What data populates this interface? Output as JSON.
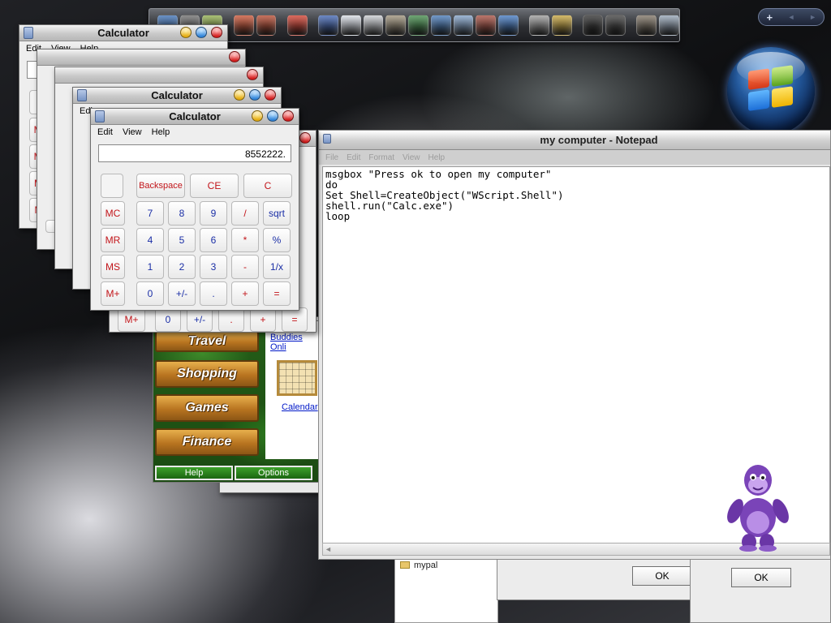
{
  "dock": {
    "icons": [
      {
        "name": "desktop-icon",
        "color": "#3a6fb5"
      },
      {
        "name": "film-reel-icon",
        "color": "#6b6b6b"
      },
      {
        "name": "disc-icon",
        "color": "#8fae4a"
      },
      {
        "name": "paint-palette-icon",
        "color": "#c94e2f"
      },
      {
        "name": "books-icon",
        "color": "#b5452b"
      },
      {
        "name": "magnet-icon",
        "color": "#d23a2a"
      },
      {
        "name": "network-icon",
        "color": "#3d62b2"
      },
      {
        "name": "document-icon",
        "color": "#d8dde6"
      },
      {
        "name": "calculator-icon",
        "color": "#c9ccd1"
      },
      {
        "name": "tools-icon",
        "color": "#9b8f77"
      },
      {
        "name": "green-book-icon",
        "color": "#3f8a47"
      },
      {
        "name": "news-icon",
        "color": "#4478b8"
      },
      {
        "name": "grid-app-icon",
        "color": "#7fa0c8"
      },
      {
        "name": "ribbon-icon",
        "color": "#a64a3c"
      },
      {
        "name": "monitor-icon",
        "color": "#3f77c2"
      },
      {
        "name": "film-scanner-icon",
        "color": "#9a9a9a"
      },
      {
        "name": "safari-compass-icon",
        "color": "#c7a43a"
      },
      {
        "name": "power-icon",
        "color": "#2a2a2a"
      },
      {
        "name": "volume-icon",
        "color": "#3a3a3a"
      },
      {
        "name": "raccoon-icon",
        "color": "#7c7162"
      },
      {
        "name": "trash-icon",
        "color": "#93a3b5"
      }
    ],
    "pager": {
      "add": "+",
      "prev": "◄",
      "next": "►"
    }
  },
  "calculators": {
    "title": "Calculator",
    "menu": [
      "Edit",
      "View",
      "Help"
    ],
    "back_display": "0.",
    "front_display": "8552222.",
    "memory_keys": [
      "MC",
      "MR",
      "MS",
      "M+"
    ],
    "top_keys": [
      "Backspace",
      "CE",
      "C"
    ],
    "rows": [
      [
        "7",
        "8",
        "9",
        "/",
        "sqrt"
      ],
      [
        "4",
        "5",
        "6",
        "*",
        "%"
      ],
      [
        "1",
        "2",
        "3",
        "-",
        "1/x"
      ],
      [
        "0",
        "+/-",
        ".",
        "+",
        "="
      ]
    ],
    "peek_keys": [
      "M+",
      "0",
      "+/-",
      ".",
      "+",
      "="
    ],
    "peek_menu": "Edi",
    "peek_key_letter": "E"
  },
  "notepad": {
    "title": "my computer - Notepad",
    "menu": [
      "File",
      "Edit",
      "Format",
      "View",
      "Help"
    ],
    "text": "msgbox \"Press ok to open my computer\"\ndo\nSet Shell=CreateObject(\"WScript.Shell\")\nshell.run(\"Calc.exe\")\nloop"
  },
  "bonzi_site": {
    "buttons": [
      "Travel",
      "Shopping",
      "Games",
      "Finance"
    ],
    "links": {
      "buddies": "Buddies Onli",
      "calendar": "Calendar"
    },
    "bottom_buttons": [
      "Help",
      "Options"
    ]
  },
  "dialogs": {
    "ok_label": "OK"
  },
  "explorer": {
    "folder": "mypal"
  }
}
